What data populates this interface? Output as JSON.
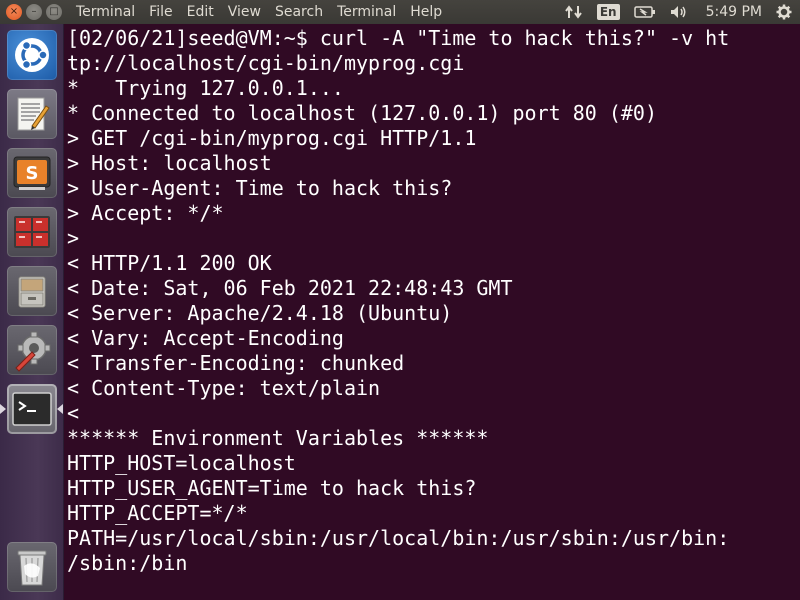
{
  "menu_bar": {
    "app_title": "Terminal",
    "items": [
      "File",
      "Edit",
      "View",
      "Search",
      "Terminal",
      "Help"
    ]
  },
  "window_controls": {
    "close": "×",
    "minimize": "–",
    "maximize": "□"
  },
  "indicators": {
    "keyboard_layout": "En",
    "clock": "5:49 PM"
  },
  "launcher": {
    "items": [
      {
        "name": "ubuntu-dash",
        "icon": "ubuntu-logo-icon"
      },
      {
        "name": "text-editor",
        "icon": "text-editor-icon"
      },
      {
        "name": "sublime-text",
        "icon": "sublime-text-icon"
      },
      {
        "name": "workspace-switcher",
        "icon": "workspace-switcher-icon"
      },
      {
        "name": "file-manager",
        "icon": "file-cabinet-icon"
      },
      {
        "name": "system-settings",
        "icon": "settings-wrench-icon"
      },
      {
        "name": "terminal",
        "icon": "terminal-icon"
      },
      {
        "name": "trash",
        "icon": "trash-icon"
      }
    ]
  },
  "terminal": {
    "lines": [
      "[02/06/21]seed@VM:~$ curl -A \"Time to hack this?\" -v ht",
      "tp://localhost/cgi-bin/myprog.cgi",
      "*   Trying 127.0.0.1...",
      "* Connected to localhost (127.0.0.1) port 80 (#0)",
      "> GET /cgi-bin/myprog.cgi HTTP/1.1",
      "> Host: localhost",
      "> User-Agent: Time to hack this?",
      "> Accept: */*",
      ">",
      "< HTTP/1.1 200 OK",
      "< Date: Sat, 06 Feb 2021 22:48:43 GMT",
      "< Server: Apache/2.4.18 (Ubuntu)",
      "< Vary: Accept-Encoding",
      "< Transfer-Encoding: chunked",
      "< Content-Type: text/plain",
      "<",
      "****** Environment Variables ******",
      "HTTP_HOST=localhost",
      "HTTP_USER_AGENT=Time to hack this?",
      "HTTP_ACCEPT=*/*",
      "PATH=/usr/local/sbin:/usr/local/bin:/usr/sbin:/usr/bin:",
      "/sbin:/bin"
    ]
  },
  "colors": {
    "terminal_bg": "#300a24",
    "terminal_fg": "#ffffff",
    "panel_bg": "#3c3b37",
    "close_button": "#e15922"
  }
}
